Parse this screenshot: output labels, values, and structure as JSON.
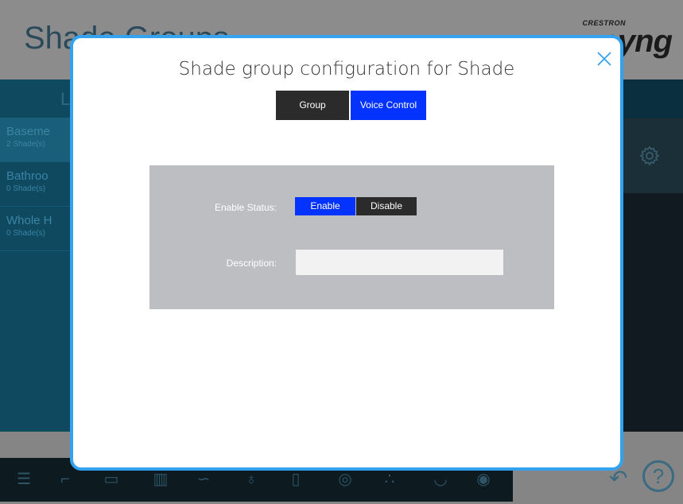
{
  "app": {
    "title": "Shade Groups",
    "brand_small": "CRESTRON",
    "brand_big": "pyng",
    "left_tab_label": "L",
    "groups": [
      {
        "name": "Baseme",
        "count": "2 Shade(s)"
      },
      {
        "name": "Bathroo",
        "count": "0 Shade(s)"
      },
      {
        "name": "Whole H",
        "count": "0 Shade(s)"
      }
    ],
    "nav_icons": [
      "menu-icon",
      "room-icon",
      "tv-icon",
      "shades-icon",
      "climate-icon",
      "light-icon",
      "door-icon",
      "security-icon",
      "scenes-icon",
      "media-icon",
      "thermostat-icon"
    ],
    "accent": "#33a3f0"
  },
  "modal": {
    "title": "Shade group configuration for Shade",
    "close_label": "×",
    "tabs": {
      "group": "Group",
      "voice_control": "Voice Control",
      "active": "voice_control"
    },
    "enable_status": {
      "label": "Enable Status:",
      "enable": "Enable",
      "disable": "Disable",
      "selected": "Enable"
    },
    "description": {
      "label": "Description:",
      "value": "",
      "placeholder": ""
    },
    "colors": {
      "active_blue": "#0433ff",
      "inactive_dark": "#2b2b2b",
      "panel_gray": "#bcbec2"
    }
  }
}
